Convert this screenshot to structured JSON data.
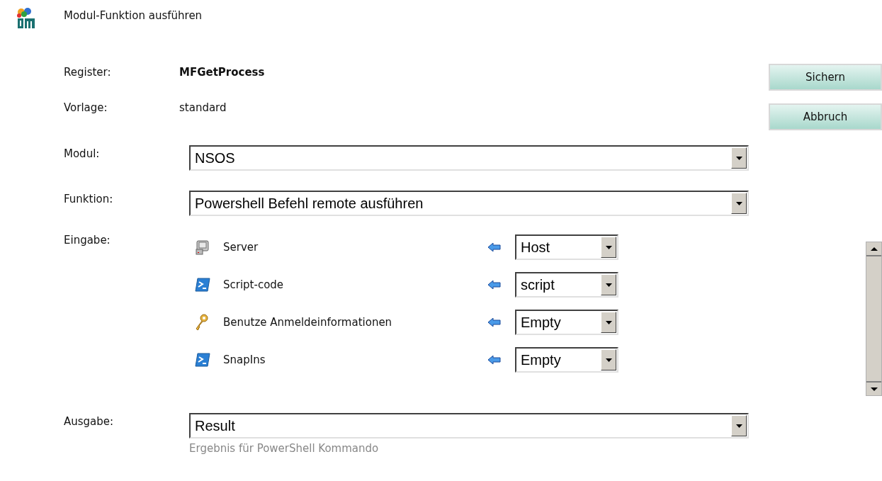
{
  "header": {
    "title": "Modul-Funktion ausführen"
  },
  "info": [
    {
      "label": "Register:",
      "value": "MFGetProcess",
      "bold": true
    },
    {
      "label": "Vorlage:",
      "value": "standard",
      "bold": false
    }
  ],
  "buttons": [
    "Sichern",
    "Abbruch"
  ],
  "modul": {
    "label": "Modul:",
    "value": "NSOS"
  },
  "funktion": {
    "label": "Funktion:",
    "value": "Powershell Befehl remote ausführen"
  },
  "eingabe": {
    "label": "Eingabe:",
    "items": [
      {
        "kind": "server",
        "name": "Server",
        "value": "Host"
      },
      {
        "kind": "script",
        "name": "Script-code",
        "value": "script"
      },
      {
        "kind": "key",
        "name": "Benutze Anmeldeinformationen",
        "value": "Empty"
      },
      {
        "kind": "script",
        "name": "SnapIns",
        "value": "Empty"
      }
    ]
  },
  "ausgabe": {
    "label": "Ausgabe:",
    "value": "Result",
    "hint": "Ergebnis für PowerShell Kommando"
  }
}
